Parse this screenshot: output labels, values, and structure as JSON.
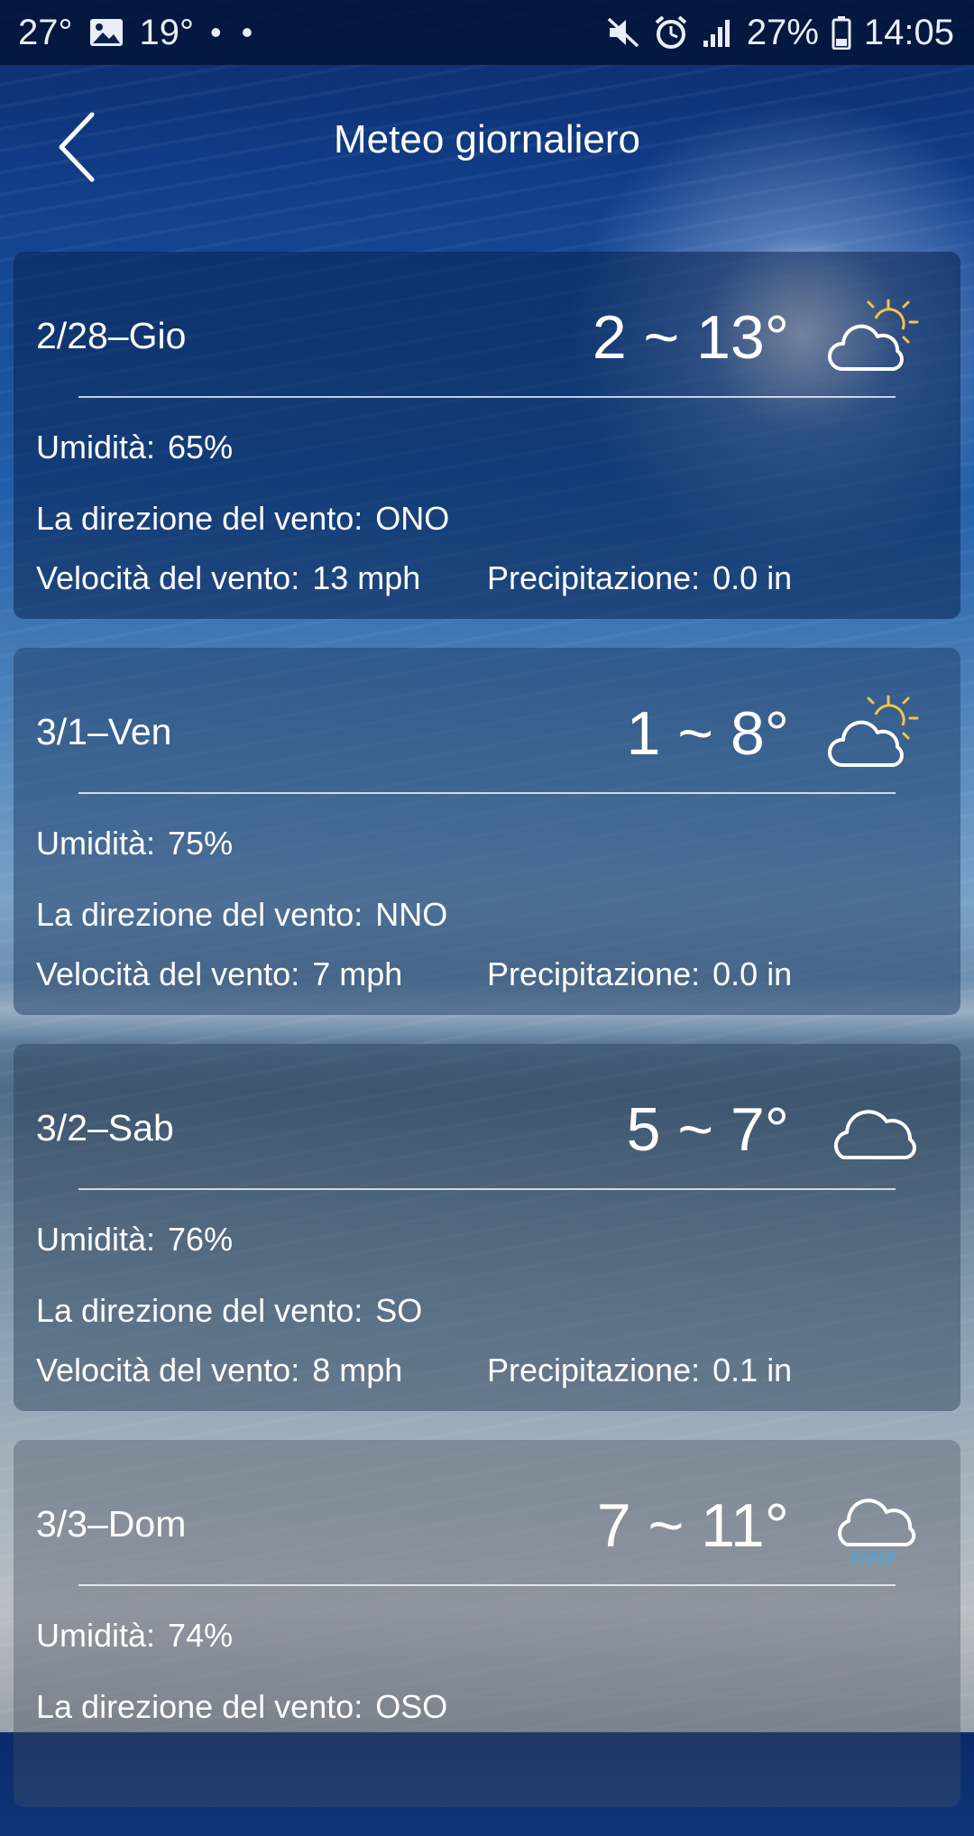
{
  "status_bar": {
    "temp_1": "27°",
    "temp_2": "19°",
    "dots": "• •",
    "battery": "27%",
    "time": "14:05"
  },
  "header": {
    "title": "Meteo giornaliero",
    "back_icon": "chevron-left-icon"
  },
  "labels": {
    "humidity": "Umidità:",
    "wind_direction": "La direzione del vento:",
    "wind_speed": "Velocità del vento:",
    "precipitation": "Precipitazione:"
  },
  "days": [
    {
      "date": "2/28–Gio",
      "temp": "2 ~ 13°",
      "icon": "partly-cloudy-icon",
      "humidity": "65%",
      "wind_direction": "ONO",
      "wind_speed": "13 mph",
      "precipitation": "0.0 in"
    },
    {
      "date": "3/1–Ven",
      "temp": "1 ~ 8°",
      "icon": "partly-cloudy-icon",
      "humidity": "75%",
      "wind_direction": "NNO",
      "wind_speed": "7 mph",
      "precipitation": "0.0 in"
    },
    {
      "date": "3/2–Sab",
      "temp": "5 ~ 7°",
      "icon": "cloud-icon",
      "humidity": "76%",
      "wind_direction": "SO",
      "wind_speed": "8 mph",
      "precipitation": "0.1 in"
    },
    {
      "date": "3/3–Dom",
      "temp": "7 ~ 11°",
      "icon": "rain-cloud-icon",
      "humidity": "74%",
      "wind_direction": "OSO",
      "wind_speed": "",
      "precipitation": ""
    }
  ],
  "colors": {
    "sun_ray": "#f5c542",
    "rain": "#3fa8e6",
    "text": "#ffffff"
  }
}
